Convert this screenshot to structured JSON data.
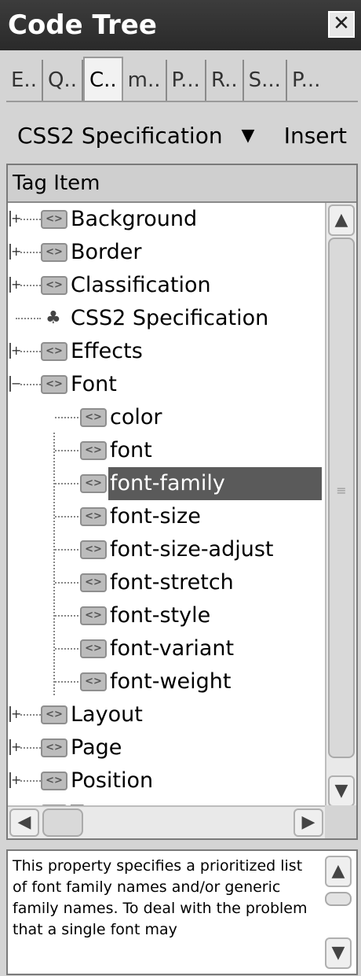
{
  "panel": {
    "title": "Code Tree",
    "close_glyph": "✕"
  },
  "tabs": [
    {
      "label": "E.."
    },
    {
      "label": "Q.."
    },
    {
      "label": "C.."
    },
    {
      "label": "m.."
    },
    {
      "label": "P..."
    },
    {
      "label": "R.."
    },
    {
      "label": "S..."
    },
    {
      "label": "P..."
    }
  ],
  "active_tab_index": 2,
  "toolbar": {
    "dropdown_value": "CSS2 Specification",
    "dropdown_arrow": "▼",
    "insert_label": "Insert"
  },
  "tree": {
    "column_header": "Tag Item",
    "items": [
      {
        "label": "Background",
        "level": 0,
        "expandable": true
      },
      {
        "label": "Border",
        "level": 0,
        "expandable": true
      },
      {
        "label": "Classification",
        "level": 0,
        "expandable": true
      },
      {
        "label": "CSS2 Specification",
        "level": 0,
        "expandable": false,
        "icon": "structure-icon"
      },
      {
        "label": "Effects",
        "level": 0,
        "expandable": true
      },
      {
        "label": "Font",
        "level": 0,
        "expandable": true,
        "expanded": true
      },
      {
        "label": "color",
        "level": 1
      },
      {
        "label": "font",
        "level": 1
      },
      {
        "label": "font-family",
        "level": 1,
        "selected": true
      },
      {
        "label": "font-size",
        "level": 1
      },
      {
        "label": "font-size-adjust",
        "level": 1
      },
      {
        "label": "font-stretch",
        "level": 1
      },
      {
        "label": "font-style",
        "level": 1
      },
      {
        "label": "font-variant",
        "level": 1
      },
      {
        "label": "font-weight",
        "level": 1
      },
      {
        "label": "Layout",
        "level": 0,
        "expandable": true
      },
      {
        "label": "Page",
        "level": 0,
        "expandable": true
      },
      {
        "label": "Position",
        "level": 0,
        "expandable": true
      },
      {
        "label": "Text",
        "level": 0,
        "expandable": true
      }
    ]
  },
  "scrollbars": {
    "up": "▲",
    "down": "▼",
    "left": "◀",
    "right": "▶",
    "grip": "≡"
  },
  "description": {
    "text": "This property specifies a prioritized list of font family names and/or generic family names. To deal with the problem that a single font may"
  },
  "colors": {
    "selection": "#5a5a5a",
    "title_bg": "#333333"
  }
}
